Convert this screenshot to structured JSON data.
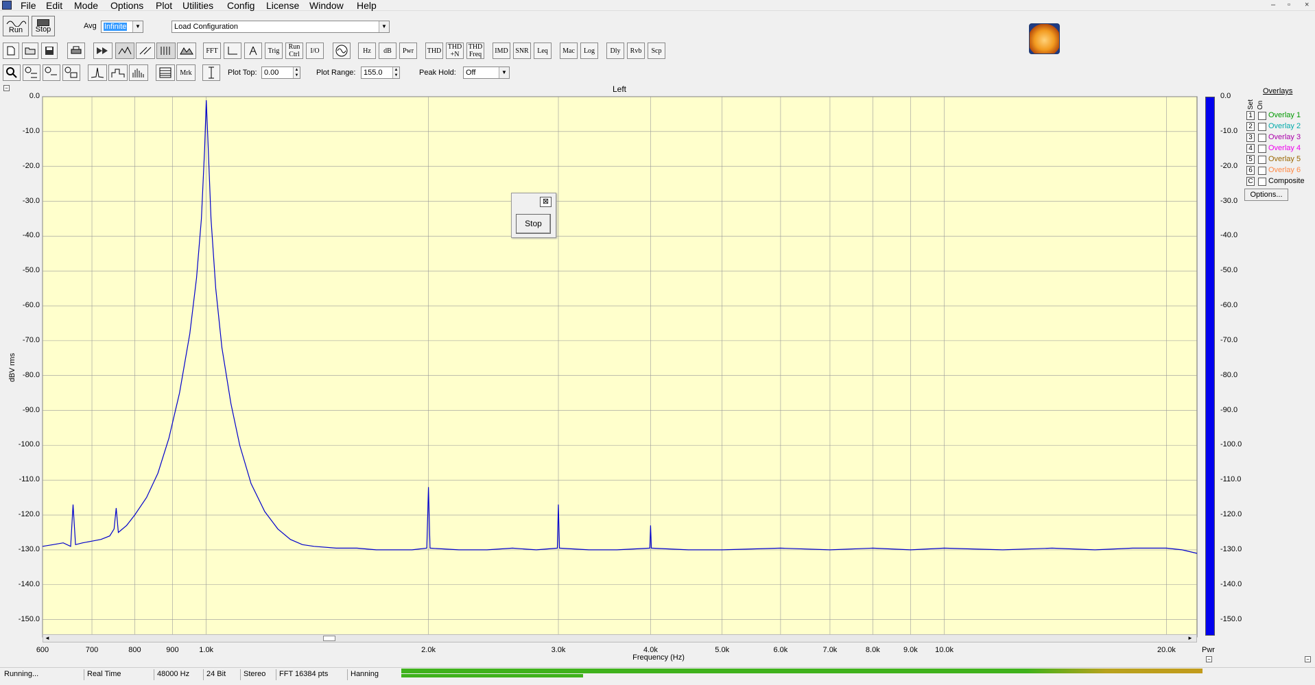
{
  "menu": {
    "items": [
      "File",
      "Edit",
      "Mode",
      "Options",
      "Plot",
      "Utilities",
      "Config",
      "License",
      "Window",
      "Help"
    ]
  },
  "window_controls": {
    "minimize": "–",
    "restore": "▫",
    "close": "×"
  },
  "toolbar": {
    "run_label": "Run",
    "stop_label": "Stop",
    "avg_label": "Avg",
    "avg_value": "Infinite",
    "config_value": "Load Configuration",
    "row2": [
      "FFT",
      "Trig",
      "Run Ctrl",
      "I/O",
      "Hz",
      "dB",
      "Pwr",
      "THD",
      "THD +N",
      "THD Freq",
      "IMD",
      "SNR",
      "Leq",
      "Mac",
      "Log",
      "Dly",
      "Rvb",
      "Scp"
    ],
    "row3_mrk": "Mrk",
    "plot_top_label": "Plot Top:",
    "plot_top_value": "0.00",
    "plot_range_label": "Plot Range:",
    "plot_range_value": "155.0",
    "peak_hold_label": "Peak Hold:",
    "peak_hold_value": "Off"
  },
  "plot": {
    "channel_title": "Left",
    "y_axis_label": "dBV rms",
    "x_axis_label": "Frequency (Hz)",
    "pwr_label": "Pwr",
    "background_color": "#ffffcc",
    "trace_color": "#0000cc"
  },
  "chart_data": {
    "type": "line",
    "title": "Left",
    "xlabel": "Frequency (Hz)",
    "ylabel": "dBV rms",
    "xscale": "log",
    "xlim": [
      600,
      22000
    ],
    "ylim": [
      -155,
      0
    ],
    "grid": true,
    "y_ticks": [
      "0.0",
      "-10.0",
      "-20.0",
      "-30.0",
      "-40.0",
      "-50.0",
      "-60.0",
      "-70.0",
      "-80.0",
      "-90.0",
      "-100.0",
      "-110.0",
      "-120.0",
      "-130.0",
      "-140.0",
      "-150.0"
    ],
    "x_ticks": [
      {
        "value": 600,
        "label": "600"
      },
      {
        "value": 700,
        "label": "700"
      },
      {
        "value": 800,
        "label": "800"
      },
      {
        "value": 900,
        "label": "900"
      },
      {
        "value": 1000,
        "label": "1.0k"
      },
      {
        "value": 2000,
        "label": "2.0k"
      },
      {
        "value": 3000,
        "label": "3.0k"
      },
      {
        "value": 4000,
        "label": "4.0k"
      },
      {
        "value": 5000,
        "label": "5.0k"
      },
      {
        "value": 6000,
        "label": "6.0k"
      },
      {
        "value": 7000,
        "label": "7.0k"
      },
      {
        "value": 8000,
        "label": "8.0k"
      },
      {
        "value": 9000,
        "label": "9.0k"
      },
      {
        "value": 10000,
        "label": "10.0k"
      },
      {
        "value": 20000,
        "label": "20.0k"
      }
    ],
    "series": [
      {
        "x": [
          600,
          620,
          640,
          655,
          660,
          665,
          680,
          700,
          720,
          740,
          750,
          755,
          760,
          780,
          800,
          830,
          860,
          890,
          920,
          950,
          970,
          985,
          995,
          1000,
          1005,
          1015,
          1030,
          1050,
          1080,
          1110,
          1150,
          1200,
          1250,
          1300,
          1350,
          1400,
          1500,
          1600,
          1700,
          1800,
          1900,
          1990,
          2000,
          2010,
          2200,
          2400,
          2600,
          2800,
          2990,
          3000,
          3010,
          3300,
          3600,
          3990,
          4000,
          4010,
          4500,
          5000,
          6000,
          7000,
          8000,
          9000,
          10000,
          12000,
          14000,
          16000,
          18000,
          20000,
          21000,
          22000
        ],
        "y": [
          -129,
          -128.5,
          -128,
          -129,
          -117,
          -128.5,
          -128,
          -127.5,
          -127,
          -126,
          -124,
          -118,
          -125,
          -123,
          -120,
          -115,
          -108,
          -98,
          -85,
          -68,
          -52,
          -35,
          -15,
          -1,
          -12,
          -35,
          -55,
          -72,
          -88,
          -100,
          -111,
          -119,
          -124,
          -127,
          -128.5,
          -129,
          -129.5,
          -129.5,
          -130,
          -130,
          -130,
          -129.5,
          -112,
          -129.5,
          -130,
          -130,
          -129.5,
          -130,
          -129.5,
          -117,
          -129.5,
          -130,
          -130,
          -129.5,
          -123,
          -129.5,
          -130,
          -130,
          -129.5,
          -130,
          -129.5,
          -130,
          -129.5,
          -130,
          -129.5,
          -130,
          -129.5,
          -129.5,
          -130,
          -131
        ]
      }
    ],
    "pwr_level_db": -150
  },
  "overlays": {
    "title": "Overlays",
    "set_label": "Set",
    "on_label": "On",
    "items": [
      {
        "num": "1",
        "name": "Overlay 1",
        "color": "#009900"
      },
      {
        "num": "2",
        "name": "Overlay 2",
        "color": "#00aaaa"
      },
      {
        "num": "3",
        "name": "Overlay 3",
        "color": "#aa00aa"
      },
      {
        "num": "4",
        "name": "Overlay 4",
        "color": "#ee00ee"
      },
      {
        "num": "5",
        "name": "Overlay 5",
        "color": "#996600"
      },
      {
        "num": "6",
        "name": "Overlay 6",
        "color": "#ff8844"
      },
      {
        "num": "C",
        "name": "Composite",
        "color": "#000000"
      }
    ],
    "options_label": "Options..."
  },
  "stop_dialog": {
    "button_label": "Stop",
    "close_glyph": "⊠"
  },
  "status": {
    "cells": [
      "Running...",
      "Real Time",
      "48000 Hz",
      "24 Bit",
      "Stereo",
      "FFT 16384 pts",
      "Hanning"
    ]
  }
}
